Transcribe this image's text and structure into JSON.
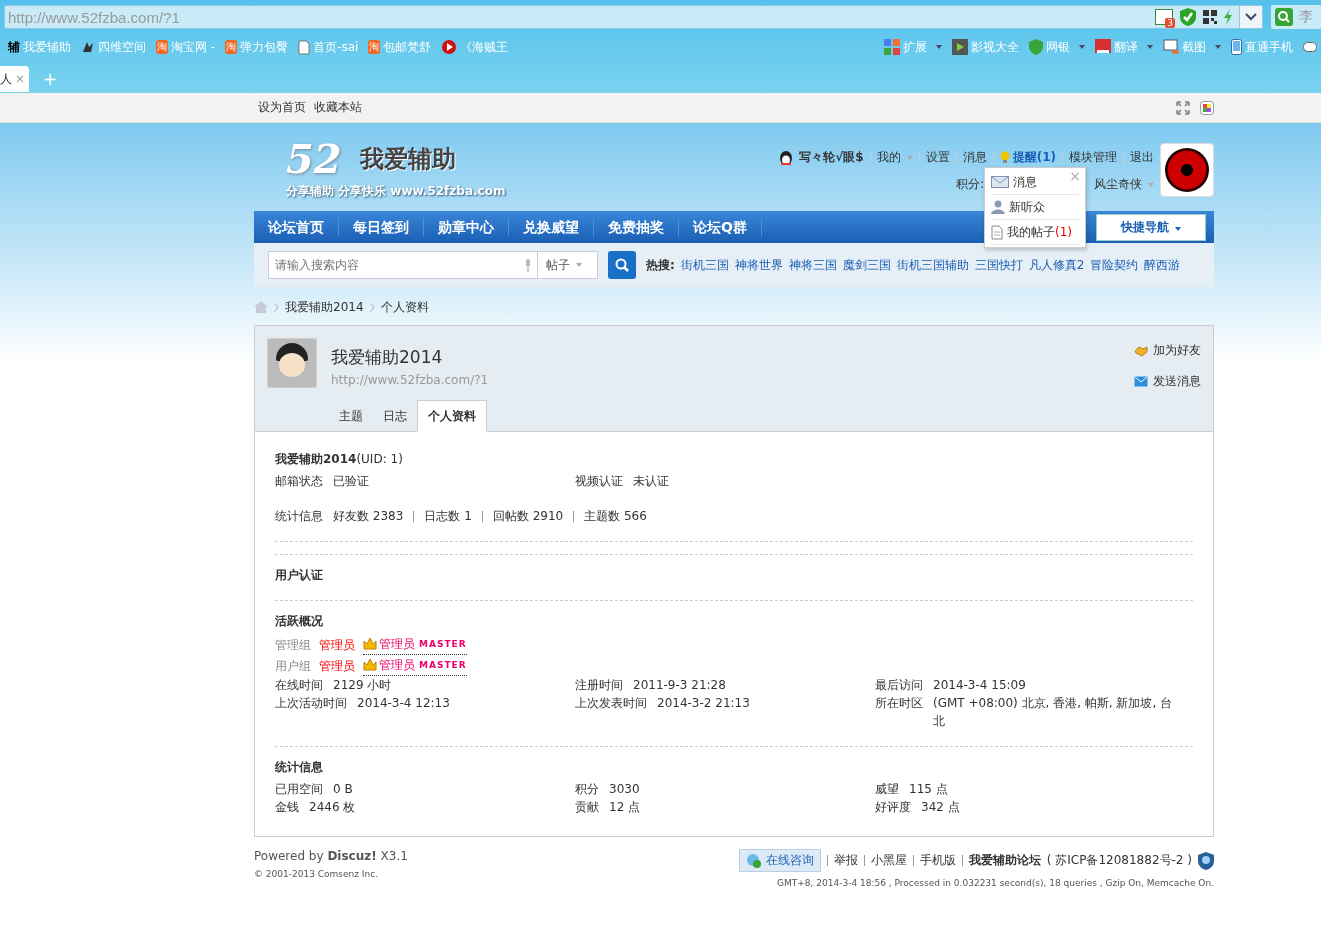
{
  "browser": {
    "address": "http://www.52fzba.com/?1",
    "address_badge": "3",
    "search_text": "李",
    "bookmarks": [
      {
        "label": "我爱辅助",
        "kind": "char",
        "icon_text": "辅"
      },
      {
        "label": "四维空间",
        "kind": "ink"
      },
      {
        "label": "淘宝网 -",
        "kind": "taobao",
        "icon_text": "淘"
      },
      {
        "label": "弹力包臀",
        "kind": "taobao",
        "icon_text": "淘"
      },
      {
        "label": "首页-sai",
        "kind": "page"
      },
      {
        "label": "包邮梵舒",
        "kind": "taobao",
        "icon_text": "淘"
      },
      {
        "label": "《海贼王",
        "kind": "play"
      }
    ],
    "tools": [
      {
        "label": "扩展",
        "kind": "grid",
        "menu": true
      },
      {
        "label": "影视大全",
        "kind": "film",
        "menu": false
      },
      {
        "label": "网银",
        "kind": "shield",
        "menu": true
      },
      {
        "label": "翻译",
        "kind": "dict",
        "menu": true
      },
      {
        "label": "截图",
        "kind": "screen",
        "menu": true
      },
      {
        "label": "直通手机",
        "kind": "phone",
        "menu": false
      }
    ],
    "tabs": [
      {
        "label": "人",
        "close": "×",
        "selected": true
      }
    ],
    "new_tab": "+"
  },
  "topbar": {
    "links": [
      "设为首页",
      "收藏本站"
    ]
  },
  "header": {
    "logo_number": "52",
    "logo_name": "我爱辅助",
    "slogan": "分享辅助 分享快乐 www.52fzba.com",
    "username": "写々轮√眼$",
    "user_links": [
      {
        "label": "我的",
        "kind": "menu"
      },
      {
        "label": "设置",
        "kind": "plain"
      },
      {
        "label": "消息",
        "kind": "plain"
      },
      {
        "label": "提醒(1)",
        "kind": "notice"
      },
      {
        "label": "模块管理",
        "kind": "plain"
      },
      {
        "label": "退出",
        "kind": "plain"
      }
    ],
    "points_label": "积分:",
    "rank": "风尘奇侠",
    "popup": {
      "close": "×",
      "items": [
        {
          "label": "消息",
          "kind": "mail"
        },
        {
          "label": "新听众",
          "kind": "person"
        },
        {
          "label": "我的帖子",
          "count": "(1)",
          "kind": "doc"
        }
      ]
    }
  },
  "nav": {
    "items": [
      "论坛首页",
      "每日签到",
      "勋章中心",
      "兑换威望",
      "免费抽奖",
      "论坛Q群"
    ],
    "quick": "快捷导航"
  },
  "search": {
    "placeholder": "请输入搜索内容",
    "type": "帖子",
    "hot_label": "热搜:",
    "hot": [
      "街机三国",
      "神将世界",
      "神将三国",
      "魔剑三国",
      "街机三国辅助",
      "三国快打",
      "凡人修真2",
      "冒险契约",
      "醉西游"
    ]
  },
  "breadcrumb": [
    "我爱辅助2014",
    "个人资料"
  ],
  "profile": {
    "name": "我爱辅助2014",
    "url": "http://www.52fzba.com/?1",
    "actions": [
      {
        "label": "加为好友",
        "kind": "friend"
      },
      {
        "label": "发送消息",
        "kind": "message"
      }
    ],
    "tabs": [
      {
        "label": "主题",
        "selected": false
      },
      {
        "label": "日志",
        "selected": false
      },
      {
        "label": "个人资料",
        "selected": true
      }
    ]
  },
  "details": {
    "title": "**我爱辅助2014**(UID: 1)",
    "verify": [
      {
        "label": "邮箱状态",
        "value": "已验证"
      },
      {
        "label": "视频认证",
        "value": "未认证"
      }
    ],
    "counts_label": "统计信息",
    "counts": [
      "好友数 2383",
      "日志数 1",
      "回帖数 2910",
      "主题数 566"
    ],
    "auth_heading": "用户认证",
    "activity_heading": "活跃概况",
    "groups": [
      {
        "label": "管理组",
        "value": "管理员",
        "title": "管理员",
        "badge": "MASTER"
      },
      {
        "label": "用户组",
        "value": "管理员",
        "title": "管理员",
        "badge": "MASTER"
      }
    ],
    "activity": [
      {
        "label": "在线时间",
        "value": "2129 小时"
      },
      {
        "label": "注册时间",
        "value": "2011-9-3 21:28"
      },
      {
        "label": "最后访问",
        "value": "2014-3-4 15:09"
      },
      {
        "label": "上次活动时间",
        "value": "2014-3-4 12:13"
      },
      {
        "label": "上次发表时间",
        "value": "2014-3-2 21:13"
      },
      {
        "label": "所在时区",
        "value": "(GMT +08:00) 北京, 香港, 帕斯, 新加坡, 台北"
      }
    ],
    "stats_heading": "统计信息",
    "stats": [
      {
        "label": "已用空间",
        "value": "0 B"
      },
      {
        "label": "积分",
        "value": "3030"
      },
      {
        "label": "威望",
        "value": "115 点"
      },
      {
        "label": "金钱",
        "value": "2446 枚"
      },
      {
        "label": "贡献",
        "value": "12 点"
      },
      {
        "label": "好评度",
        "value": "342 点"
      }
    ]
  },
  "footer": {
    "powered": "Powered by **Discuz!** X3.1",
    "copyright": "© 2001-2013 Comsenz Inc.",
    "service": "在线咨询",
    "links": [
      "举报",
      "小黑屋",
      "手机版"
    ],
    "site": "我爱辅助论坛",
    "icp": "( 苏ICP备12081882号-2 )",
    "debug": "GMT+8, 2014-3-4 18:56 , Processed in 0.032231 second(s), 18 queries , Gzip On, Memcache On."
  }
}
